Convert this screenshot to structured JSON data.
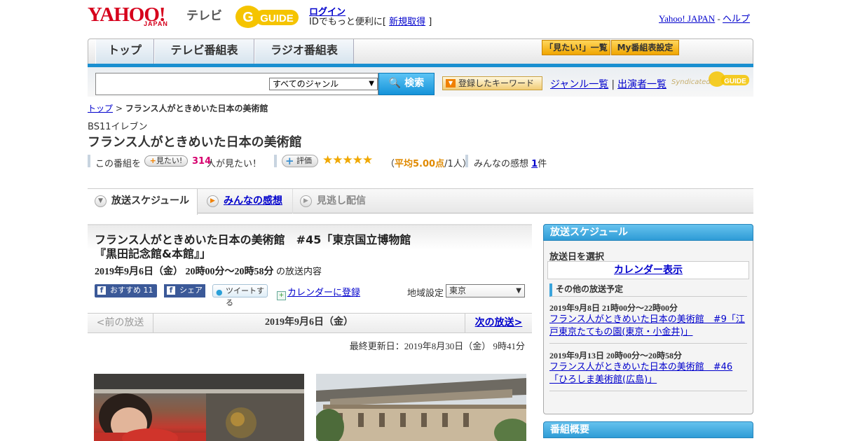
{
  "header": {
    "logo_yahoo": "YAHOO!",
    "logo_japan": "JAPAN",
    "logo_tv": "テレビ",
    "logo_gguide": "GUIDE",
    "login_link": "ログイン",
    "login_text_pre": "IDでもっと便利に[",
    "signup_link": "新規取得",
    "login_text_post": "]",
    "yahoo_japan_link": "Yahoo! JAPAN",
    "sep": "-",
    "help_link": "ヘルプ"
  },
  "nav": {
    "tabs": [
      {
        "label": "トップ"
      },
      {
        "label": "テレビ番組表"
      },
      {
        "label": "ラジオ番組表"
      }
    ],
    "mitai_list": "「見たい!」一覧",
    "my_bangumi": "My番組表設定"
  },
  "search": {
    "genre": "すべてのジャンル",
    "button": "検索",
    "keyword_button": "登録したキーワード",
    "genre_list": "ジャンル一覧",
    "divider": "|",
    "cast_list": "出演者一覧",
    "syndicated": "Syndicated"
  },
  "breadcrumb": {
    "top": "トップ",
    "sep": ">",
    "current": "フランス人がときめいた日本の美術館"
  },
  "program": {
    "channel": "BS11イレブン",
    "title": "フランス人がときめいた日本の美術館",
    "stat_prefix": "この番組を",
    "mitai_badge": "見たい!",
    "mitai_count": "314",
    "mitai_suffix": "人が見たい！",
    "hyoka_badge": "評価",
    "stars": "★★★★★",
    "avg_open": "（",
    "avg_value": "平均5.00点",
    "avg_close": "/1人）",
    "kanso_label": "みんなの感想",
    "kanso_count": "1",
    "kanso_suffix": "件"
  },
  "subtabs": {
    "schedule": "放送スケジュール",
    "kanso": "みんなの感想",
    "minogashi": "見逃し配信"
  },
  "episode": {
    "title": "フランス人がときめいた日本の美術館　#45「東京国立博物館『黒田記念館&本館』」",
    "datetime": "2019年9月6日（金） 20時00分～20時58分",
    "datetime_suffix": "の放送内容",
    "osusume": "おすすめ 11",
    "share": "シェア",
    "tweet": "ツイートする",
    "calendar": "カレンダーに登録",
    "region_label": "地域設定",
    "region_value": "東京"
  },
  "pager": {
    "prev": "<前の放送",
    "date": "2019年9月6日（金）",
    "next": "次の放送>"
  },
  "updated": "最終更新日：2019年8月30日（金） 9時41分",
  "sidebar": {
    "schedule_head": "放送スケジュール",
    "select_label": "放送日を選択",
    "calendar": "カレンダー表示",
    "other_head": "その他の放送予定",
    "items": [
      {
        "datetime": "2019年9月8日 21時00分～22時00分",
        "title": "フランス人がときめいた日本の美術館　#9「江戸東京たてもの園(東京・小金井)」"
      },
      {
        "datetime": "2019年9月13日 20時00分～20時58分",
        "title": "フランス人がときめいた日本の美術館　#46「ひろしま美術館(広島)」"
      }
    ],
    "gaiyo_head": "番組概要"
  },
  "colors": {
    "accent_blue": "#1a8fd0",
    "yahoo_red": "#d6001c",
    "star": "#f0a800",
    "mitai_count": "#d6006e"
  }
}
